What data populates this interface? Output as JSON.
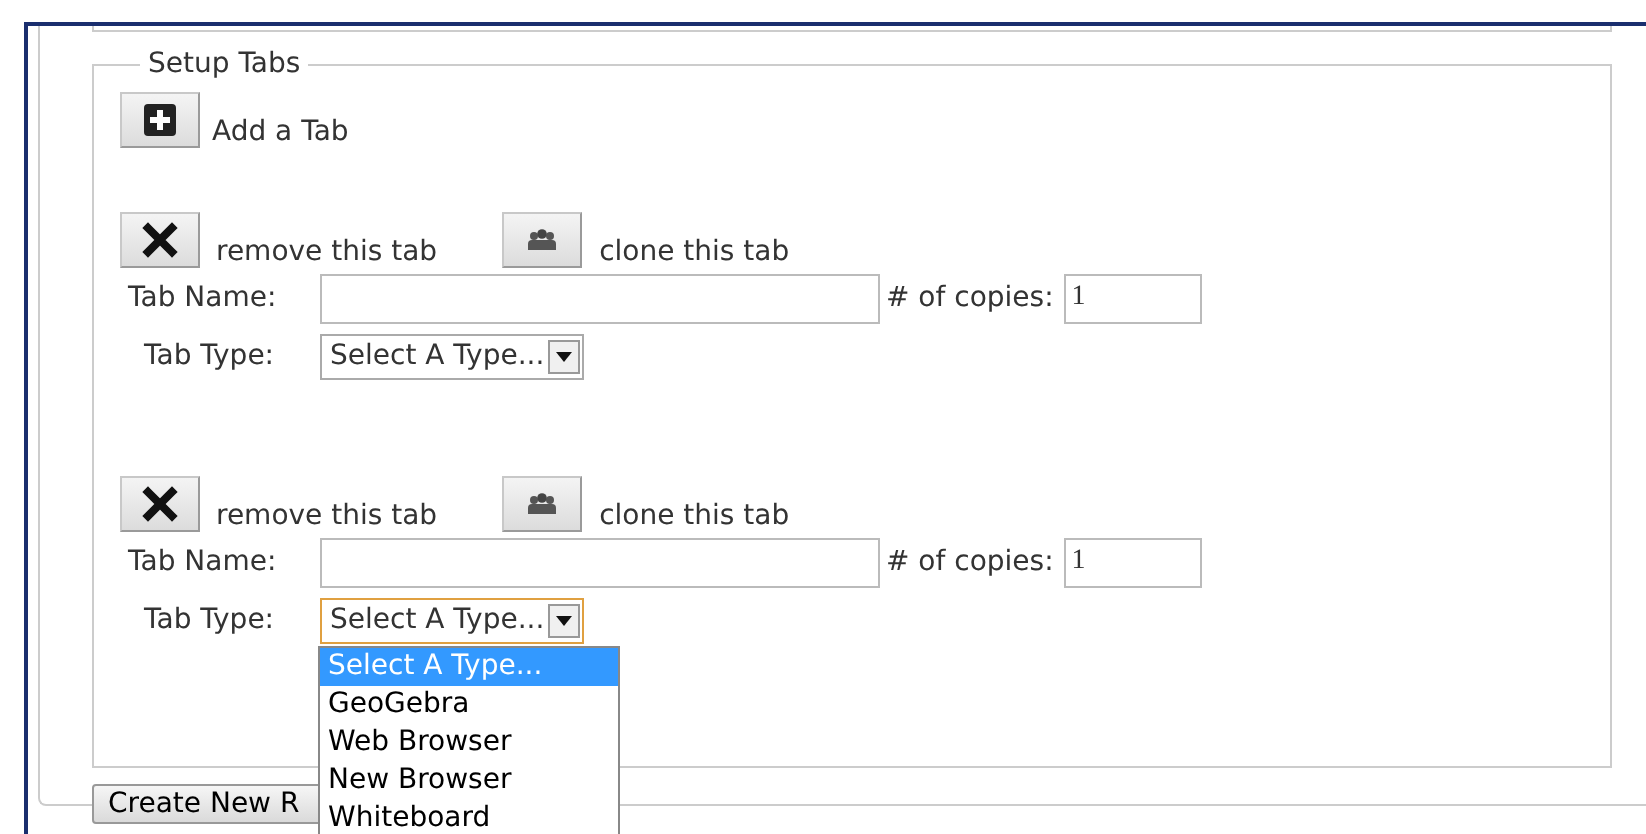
{
  "fieldset": {
    "legend": "Setup Tabs"
  },
  "add_button": {
    "label": "Add a Tab"
  },
  "tabs": [
    {
      "remove_label": "remove this tab",
      "clone_label": "clone this tab",
      "name_label": "Tab Name:",
      "copies_label": "# of copies:",
      "copies_value": "1",
      "type_label": "Tab Type:",
      "type_value": "Select A Type...",
      "focused": false
    },
    {
      "remove_label": "remove this tab",
      "clone_label": "clone this tab",
      "name_label": "Tab Name:",
      "copies_label": "# of copies:",
      "copies_value": "1",
      "type_label": "Tab Type:",
      "type_value": "Select A Type...",
      "focused": true,
      "options": [
        {
          "label": "Select A Type...",
          "selected": true
        },
        {
          "label": "GeoGebra",
          "selected": false
        },
        {
          "label": "Web Browser",
          "selected": false
        },
        {
          "label": "New Browser",
          "selected": false
        },
        {
          "label": "Whiteboard",
          "selected": false
        }
      ]
    }
  ],
  "create_button": {
    "label": "Create New R"
  }
}
